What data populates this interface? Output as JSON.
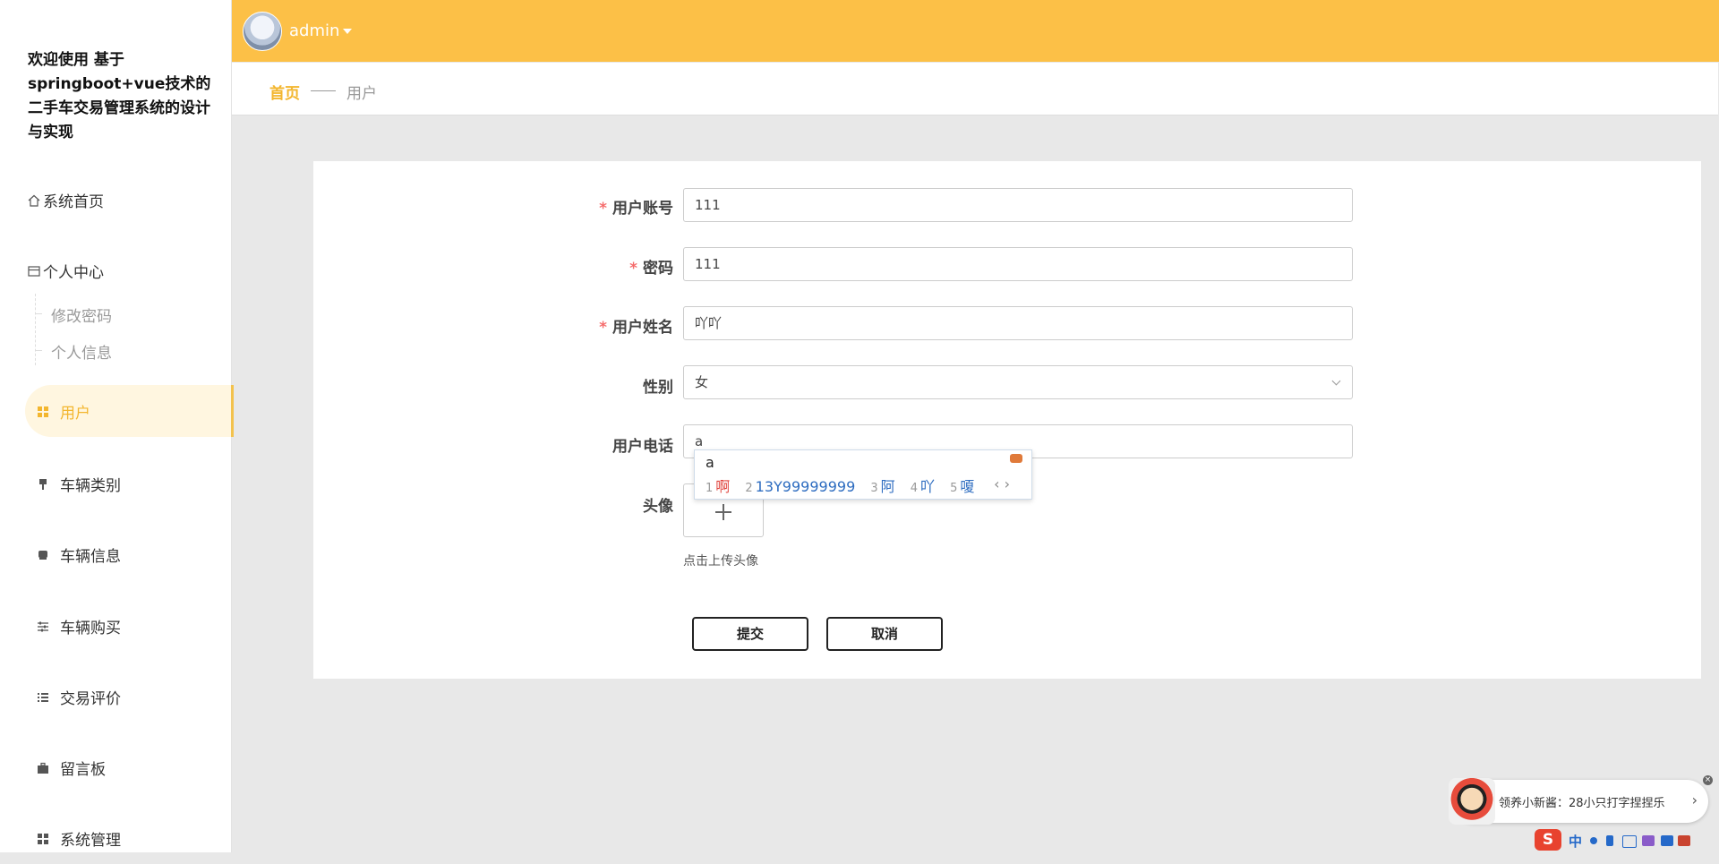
{
  "site_title": "欢迎使用 基于springboot+vue技术的二手车交易管理系统的设计与实现",
  "sidebar": {
    "home": "系统首页",
    "personal_center": "个人中心",
    "sub_items": [
      "修改密码",
      "个人信息"
    ],
    "items": [
      {
        "label": "用户",
        "icon": "grid-icon",
        "active": true
      },
      {
        "label": "车辆类别",
        "icon": "category-icon"
      },
      {
        "label": "车辆信息",
        "icon": "car-info-icon"
      },
      {
        "label": "车辆购买",
        "icon": "sliders-icon"
      },
      {
        "label": "交易评价",
        "icon": "list-icon"
      },
      {
        "label": "留言板",
        "icon": "briefcase-icon"
      },
      {
        "label": "系统管理",
        "icon": "grid-icon"
      }
    ]
  },
  "topbar": {
    "user": "admin",
    "color": "#fcc047"
  },
  "breadcrumb": {
    "home": "首页",
    "current": "用户"
  },
  "form": {
    "account": {
      "label": "用户账号",
      "value": "111",
      "required": true
    },
    "password": {
      "label": "密码",
      "value": "111",
      "required": true
    },
    "name": {
      "label": "用户姓名",
      "value": "吖吖",
      "required": true
    },
    "gender": {
      "label": "性别",
      "value": "女"
    },
    "phone": {
      "label": "用户电话",
      "value": "a"
    },
    "avatar": {
      "label": "头像",
      "tip": "点击上传头像"
    },
    "submit": "提交",
    "cancel": "取消",
    "required_mark": "*"
  },
  "ime_popup": {
    "typed": "a",
    "candidates": [
      {
        "n": "1",
        "text": "啊"
      },
      {
        "n": "2",
        "text": "13Y99999999"
      },
      {
        "n": "3",
        "text": "阿"
      },
      {
        "n": "4",
        "text": "吖"
      },
      {
        "n": "5",
        "text": "嗄"
      }
    ],
    "nav": "‹ ›"
  },
  "toast": {
    "text": "领养小新酱：28小只打字捏捏乐",
    "arrow": "›",
    "close": "×"
  },
  "ime_bar": {
    "logo": "S",
    "mode": "中"
  }
}
